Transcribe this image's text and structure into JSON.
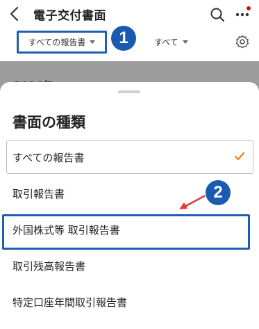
{
  "header": {
    "title": "電子交付書面",
    "back_icon": "chevron-left-icon",
    "search_icon": "search-icon",
    "more_icon": "more-dots-icon"
  },
  "filters": {
    "report_type": "すべての報告書",
    "account": "すべて"
  },
  "background": {
    "year_label": "2024年"
  },
  "sheet": {
    "title": "書面の種類",
    "options": [
      {
        "label": "すべての報告書",
        "selected": true
      },
      {
        "label": "取引報告書",
        "selected": false
      },
      {
        "label": "外国株式等 取引報告書",
        "selected": false
      },
      {
        "label": "取引残高報告書",
        "selected": false
      },
      {
        "label": "特定口座年間取引報告書",
        "selected": false
      }
    ]
  },
  "annotations": {
    "badge_1": "1",
    "badge_2": "2",
    "highlight_color": "#1f5fb3",
    "badge_color": "#1a5ab0",
    "arrow_color": "#e53935"
  },
  "colors": {
    "check": "#f07b18",
    "notification_dot": "#e60012"
  }
}
